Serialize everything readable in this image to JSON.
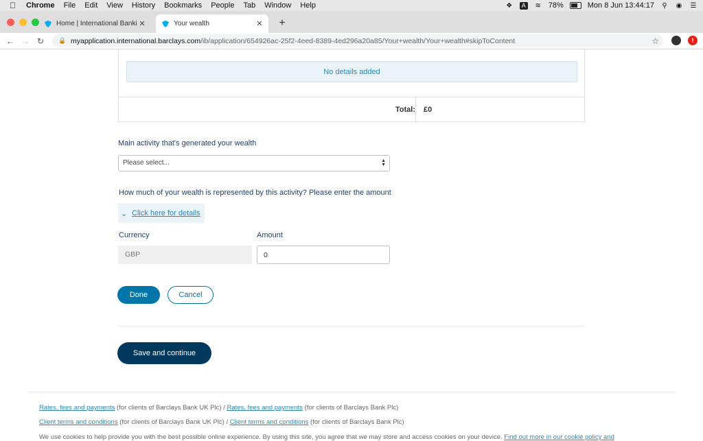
{
  "menubar": {
    "app": "Chrome",
    "items": [
      "File",
      "Edit",
      "View",
      "History",
      "Bookmarks",
      "People",
      "Tab",
      "Window",
      "Help"
    ],
    "battery": "78%",
    "datetime": "Mon 8 Jun  13:44:17"
  },
  "tabs": [
    {
      "title": "Home | International Banking |",
      "active": false
    },
    {
      "title": "Your wealth",
      "active": true
    }
  ],
  "address": {
    "host": "myapplication.international.barclays.com",
    "path": "/ib/application/654926ac-25f2-4eed-8389-4ed296a20a85/Your+wealth/Your+wealth#skipToContent"
  },
  "panel": {
    "empty_text": "No details added",
    "total_label": "Total:",
    "total_value": "£0"
  },
  "form": {
    "activity_label": "Main activity that's generated your wealth",
    "activity_selected": "Please select...",
    "amount_question": "How much of your wealth is represented by this activity? Please enter the amount",
    "details_link": "Click here for details",
    "currency_label": "Currency",
    "currency_value": "GBP",
    "amount_label": "Amount",
    "amount_value": "0"
  },
  "buttons": {
    "done": "Done",
    "cancel": "Cancel",
    "save": "Save and continue"
  },
  "footer": {
    "row1": [
      {
        "link": "Rates, fees and payments",
        "text": " (for clients of Barclays Bank UK Plc) / "
      },
      {
        "link": "Rates, fees and payments",
        "text": " (for clients of Barclays Bank Plc)"
      }
    ],
    "row2": [
      {
        "link": "Client terms and conditions",
        "text": " (for clients of Barclays Bank UK Plc) / "
      },
      {
        "link": "Client terms and conditions",
        "text": " (for clients of Barclays Bank Plc)"
      }
    ],
    "cookie_text": "We use cookies to help provide you with the best possible online experience. By using this site, you agree that we may store and access cookies on your device. ",
    "cookie_link": "Find out more in our cookie policy and"
  },
  "colors": {
    "brand_blue": "#0076a8",
    "dark_navy": "#00395d",
    "link_blue": "#2e86b0"
  }
}
